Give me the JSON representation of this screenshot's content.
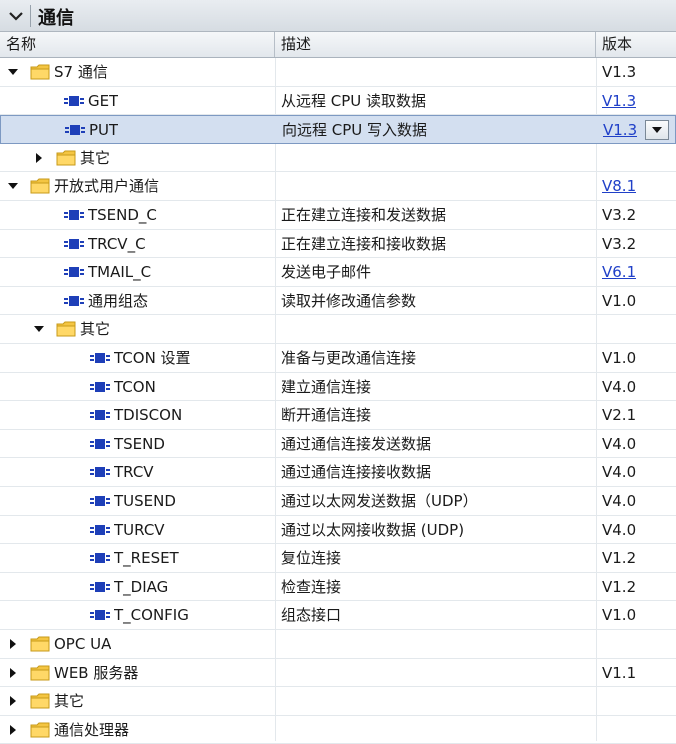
{
  "panel": {
    "title": "通信"
  },
  "columns": {
    "name": "名称",
    "description": "描述",
    "version": "版本"
  },
  "rows": [
    {
      "name": "S7 通信",
      "description": "",
      "version": "V1.3",
      "type": "folder",
      "level": 0,
      "toggle": "expanded",
      "link": false
    },
    {
      "name": "GET",
      "description": "从远程 CPU 读取数据",
      "version": "V1.3",
      "type": "block",
      "level": 1,
      "toggle": "none",
      "link": true
    },
    {
      "name": "PUT",
      "description": "向远程 CPU 写入数据",
      "version": "V1.3",
      "type": "block",
      "level": 1,
      "toggle": "none",
      "link": true,
      "selected": true
    },
    {
      "name": "其它",
      "description": "",
      "version": "",
      "type": "folder",
      "level": 1,
      "toggle": "collapsed",
      "link": false
    },
    {
      "name": "开放式用户通信",
      "description": "",
      "version": "V8.1",
      "type": "folder",
      "level": 0,
      "toggle": "expanded",
      "link": true
    },
    {
      "name": "TSEND_C",
      "description": "正在建立连接和发送数据",
      "version": "V3.2",
      "type": "block",
      "level": 1,
      "toggle": "none",
      "link": false
    },
    {
      "name": "TRCV_C",
      "description": "正在建立连接和接收数据",
      "version": "V3.2",
      "type": "block",
      "level": 1,
      "toggle": "none",
      "link": false
    },
    {
      "name": "TMAIL_C",
      "description": "发送电子邮件",
      "version": "V6.1",
      "type": "block",
      "level": 1,
      "toggle": "none",
      "link": true
    },
    {
      "name": "通用组态",
      "description": "读取并修改通信参数",
      "version": "V1.0",
      "type": "block",
      "level": 1,
      "toggle": "none",
      "link": false
    },
    {
      "name": "其它",
      "description": "",
      "version": "",
      "type": "folder",
      "level": 1,
      "toggle": "expanded",
      "link": false
    },
    {
      "name": "TCON 设置",
      "description": "准备与更改通信连接",
      "version": "V1.0",
      "type": "block",
      "level": 2,
      "toggle": "none",
      "link": false
    },
    {
      "name": "TCON",
      "description": "建立通信连接",
      "version": "V4.0",
      "type": "block",
      "level": 2,
      "toggle": "none",
      "link": false
    },
    {
      "name": "TDISCON",
      "description": "断开通信连接",
      "version": "V2.1",
      "type": "block",
      "level": 2,
      "toggle": "none",
      "link": false
    },
    {
      "name": "TSEND",
      "description": "通过通信连接发送数据",
      "version": "V4.0",
      "type": "block",
      "level": 2,
      "toggle": "none",
      "link": false
    },
    {
      "name": "TRCV",
      "description": "通过通信连接接收数据",
      "version": "V4.0",
      "type": "block",
      "level": 2,
      "toggle": "none",
      "link": false
    },
    {
      "name": "TUSEND",
      "description": "通过以太网发送数据（UDP）",
      "version": "V4.0",
      "type": "block",
      "level": 2,
      "toggle": "none",
      "link": false
    },
    {
      "name": "TURCV",
      "description": "通过以太网接收数据 (UDP)",
      "version": "V4.0",
      "type": "block",
      "level": 2,
      "toggle": "none",
      "link": false
    },
    {
      "name": "T_RESET",
      "description": "复位连接",
      "version": "V1.2",
      "type": "block",
      "level": 2,
      "toggle": "none",
      "link": false
    },
    {
      "name": "T_DIAG",
      "description": "检查连接",
      "version": "V1.2",
      "type": "block",
      "level": 2,
      "toggle": "none",
      "link": false
    },
    {
      "name": "T_CONFIG",
      "description": "组态接口",
      "version": "V1.0",
      "type": "block",
      "level": 2,
      "toggle": "none",
      "link": false
    },
    {
      "name": "OPC UA",
      "description": "",
      "version": "",
      "type": "folder",
      "level": 0,
      "toggle": "collapsed",
      "link": false
    },
    {
      "name": "WEB 服务器",
      "description": "",
      "version": "V1.1",
      "type": "folder",
      "level": 0,
      "toggle": "collapsed",
      "link": false
    },
    {
      "name": "其它",
      "description": "",
      "version": "",
      "type": "folder",
      "level": 0,
      "toggle": "collapsed",
      "link": false
    },
    {
      "name": "通信处理器",
      "description": "",
      "version": "",
      "type": "folder",
      "level": 0,
      "toggle": "collapsed",
      "link": false
    }
  ],
  "colors": {
    "folder": "#f4c542",
    "block": "#1e3fb8",
    "link": "#2040c8",
    "selected": "#d3dff0"
  }
}
